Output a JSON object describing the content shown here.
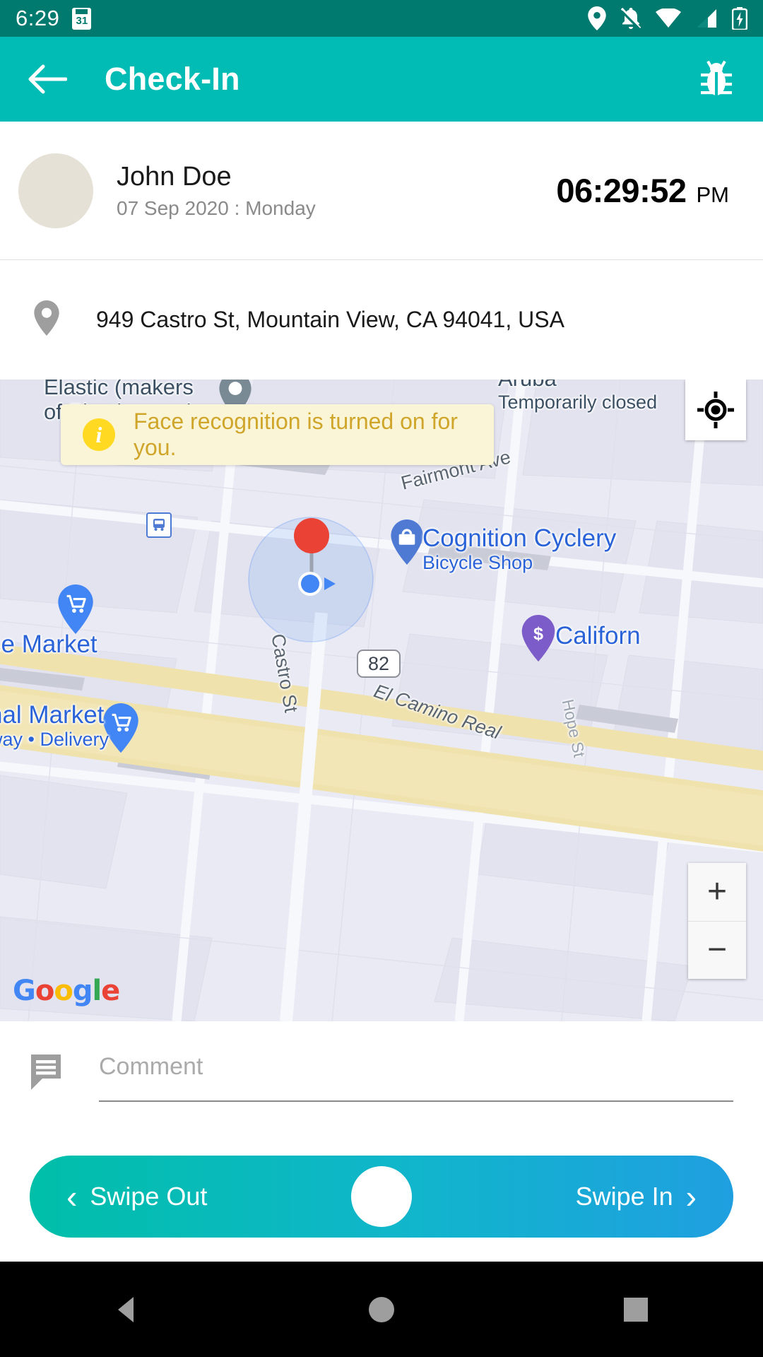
{
  "status_bar": {
    "time": "6:29",
    "icons": [
      "calendar-icon",
      "location-icon",
      "notifications-off-icon",
      "wifi-icon",
      "signal-icon",
      "battery-charging-icon"
    ]
  },
  "app_bar": {
    "back_icon": "back-arrow-icon",
    "title": "Check-In",
    "action_icon": "bug-report-icon"
  },
  "user": {
    "name": "John Doe",
    "date": "07 Sep 2020 : Monday",
    "time": "06:29:52",
    "meridiem": "PM",
    "avatar_icon": "avatar"
  },
  "location": {
    "pin_icon": "location-pin-icon",
    "address": "949 Castro St, Mountain View, CA 94041, USA"
  },
  "map": {
    "banner": {
      "icon": "info-icon",
      "icon_glyph": "i",
      "text": "Face recognition is turned on for you."
    },
    "my_location_icon": "my-location-icon",
    "zoom_in_label": "+",
    "zoom_out_label": "−",
    "attribution": "Google",
    "attribution_letters": [
      "G",
      "o",
      "o",
      "g",
      "l",
      "e"
    ],
    "highway_badge": "82",
    "pois": [
      {
        "name": "Elastic (makers",
        "name2": "of Elasticsearch…",
        "type": "place"
      },
      {
        "name": "Aruba",
        "name2": "Temporarily closed",
        "type": "place"
      },
      {
        "name": "Cognition Cyclery",
        "name2": "Bicycle Shop",
        "type": "bicycle-shop"
      },
      {
        "name": "se Market",
        "type": "grocery"
      },
      {
        "name": "nal Market",
        "name2": "way • Delivery",
        "type": "grocery"
      },
      {
        "name": "Californ",
        "type": "bank"
      }
    ],
    "streets": [
      "Fairmont Ave",
      "Castro St",
      "El Camino Real",
      "Hope St"
    ]
  },
  "comment": {
    "icon": "comment-icon",
    "value": "",
    "placeholder": "Comment"
  },
  "swipe": {
    "out_label": "Swipe Out",
    "out_chevron": "‹",
    "in_label": "Swipe In",
    "in_chevron": "›"
  },
  "nav_bar": {
    "back_icon": "nav-back-icon",
    "home_icon": "nav-home-icon",
    "recents_icon": "nav-recents-icon"
  },
  "colors": {
    "status_bar": "#00796e",
    "app_bar": "#00bcb4",
    "banner_bg": "#fbf5d8",
    "banner_text": "#cfa52a",
    "swipe_start": "#00bfa9",
    "swipe_end": "#1f9fe0"
  }
}
